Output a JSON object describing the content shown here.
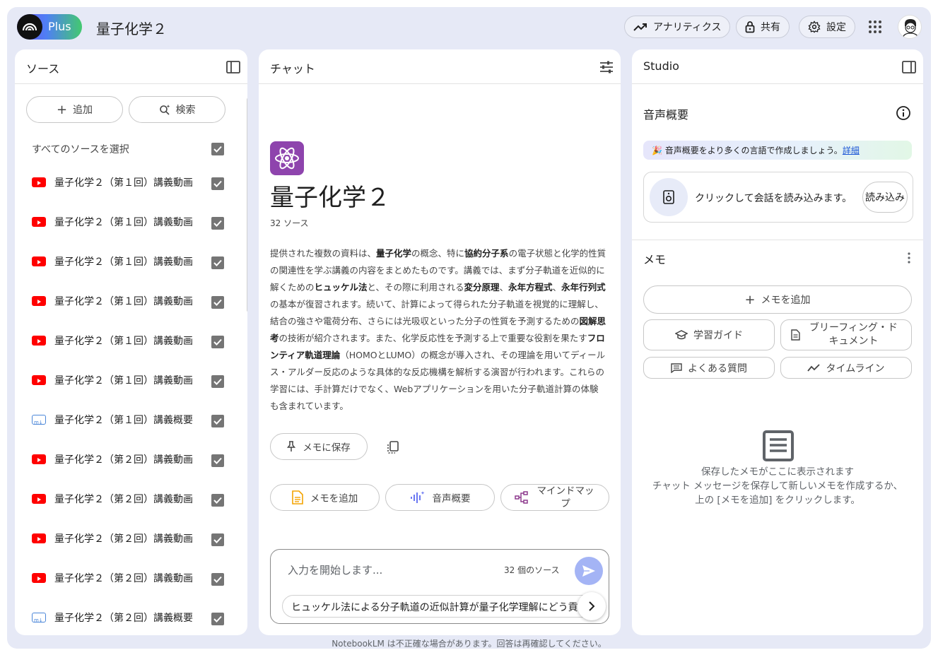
{
  "app": {
    "plan_badge": "Plus",
    "notebook_title": "量子化学２"
  },
  "topbar": {
    "analytics_label": "アナリティクス",
    "share_label": "共有",
    "settings_label": "設定"
  },
  "sources": {
    "title": "ソース",
    "add_label": "追加",
    "search_label": "検索",
    "select_all_label": "すべてのソースを選択",
    "items": [
      {
        "type": "youtube",
        "label": "量子化学２（第１回）講義動画"
      },
      {
        "type": "youtube",
        "label": "量子化学２（第１回）講義動画"
      },
      {
        "type": "youtube",
        "label": "量子化学２（第１回）講義動画"
      },
      {
        "type": "youtube",
        "label": "量子化学２（第１回）講義動画"
      },
      {
        "type": "youtube",
        "label": "量子化学２（第１回）講義動画"
      },
      {
        "type": "youtube",
        "label": "量子化学２（第１回）講義動画"
      },
      {
        "type": "markdown",
        "label": "量子化学２（第１回）講義概要"
      },
      {
        "type": "youtube",
        "label": "量子化学２（第２回）講義動画"
      },
      {
        "type": "youtube",
        "label": "量子化学２（第２回）講義動画"
      },
      {
        "type": "youtube",
        "label": "量子化学２（第２回）講義動画"
      },
      {
        "type": "youtube",
        "label": "量子化学２（第２回）講義動画"
      },
      {
        "type": "markdown",
        "label": "量子化学２（第２回）講義概要"
      }
    ]
  },
  "chat": {
    "title": "チャット",
    "notebook_title": "量子化学２",
    "source_count": "32 ソース",
    "summary_parts": [
      {
        "t": "提供された複数の資料は、",
        "b": false
      },
      {
        "t": "量子化学",
        "b": true
      },
      {
        "t": "の概念、特に",
        "b": false
      },
      {
        "t": "協約分子系",
        "b": true
      },
      {
        "t": "の電子状態と化学的性質の関連性を学ぶ講義の内容をまとめたものです。講義では、まず分子軌道を近似的に解くための",
        "b": false
      },
      {
        "t": "ヒュッケル法",
        "b": true
      },
      {
        "t": "と、その際に利用される",
        "b": false
      },
      {
        "t": "変分原理",
        "b": true
      },
      {
        "t": "、",
        "b": false
      },
      {
        "t": "永年方程式",
        "b": true
      },
      {
        "t": "、",
        "b": false
      },
      {
        "t": "永年行列式",
        "b": true
      },
      {
        "t": "の基本が復習されます。続いて、計算によって得られた分子軌道を視覚的に理解し、結合の強さや電荷分布、さらには光吸収といった分子の性質を予測するための",
        "b": false
      },
      {
        "t": "図解思考",
        "b": true
      },
      {
        "t": "の技術が紹介されます。また、化学反応性を予測する上で重要な役割を果たす",
        "b": false
      },
      {
        "t": "フロンティア軌道理論",
        "b": true
      },
      {
        "t": "（HOMOとLUMO）の概念が導入され、その理論を用いてディールス・アルダー反応のような具体的な反応機構を解析する演習が行われます。これらの学習には、手計算だけでなく、Webアプリケーションを用いた分子軌道計算の体験も含まれています。",
        "b": false
      }
    ],
    "save_to_memo_label": "メモに保存",
    "add_memo_label": "メモを追加",
    "audio_overview_label": "音声概要",
    "mindmap_label": "マインドマップ",
    "input_placeholder": "入力を開始します...",
    "input_source_count": "32 個のソース",
    "suggestion": "ヒュッケル法による分子軌道の近似計算が量子化学理解にどう貢献しますか？"
  },
  "studio": {
    "title": "Studio",
    "audio_title": "音声概要",
    "banner_text": "🎉 音声概要をより多くの言語で作成しましょう。",
    "banner_link": "詳細",
    "audio_card_text": "クリックして会話を読み込みます。",
    "load_label": "読み込み",
    "memo_title": "メモ",
    "add_memo_label": "メモを追加",
    "study_guide_label": "学習ガイド",
    "briefing_label": "ブリーフィング・ドキュメント",
    "faq_label": "よくある質問",
    "timeline_label": "タイムライン",
    "empty_line1": "保存したメモがここに表示されます",
    "empty_line2": "チャット メッセージを保存して新しいメモを作成するか、",
    "empty_line3": "上の [メモを追加] をクリックします。"
  },
  "footer": "NotebookLM は不正確な場合があります。回答は再確認してください。",
  "colors": {
    "window_bg": "#e6e9f6",
    "youtube_red": "#ff0000",
    "send_button": "#a4b4f5",
    "link_blue": "#1a55d6"
  }
}
